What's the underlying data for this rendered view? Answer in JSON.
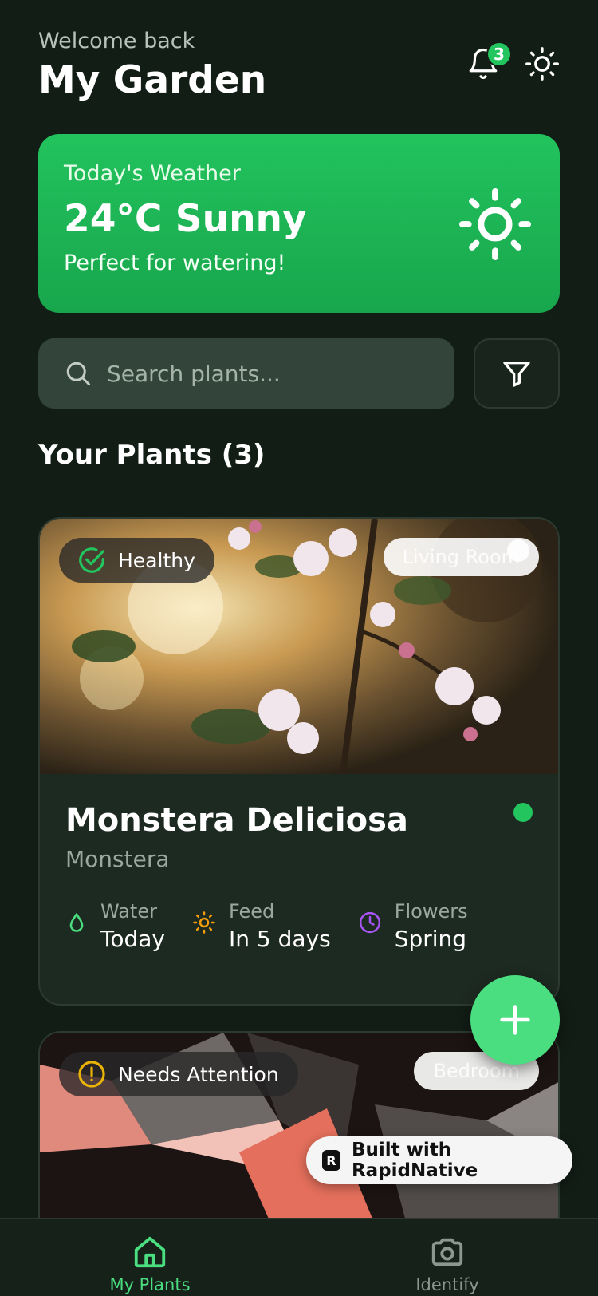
{
  "header": {
    "welcome": "Welcome back",
    "title": "My Garden",
    "notifications_count": "3"
  },
  "weather": {
    "label": "Today's Weather",
    "temperature": "24°C Sunny",
    "note": "Perfect for watering!"
  },
  "search": {
    "placeholder": "Search plants..."
  },
  "plants_section": {
    "title": "Your Plants (3)"
  },
  "plants": [
    {
      "status": "Healthy",
      "room": "Living Room",
      "name": "Monstera Deliciosa",
      "type": "Monstera",
      "stats": [
        {
          "label": "Water",
          "value": "Today"
        },
        {
          "label": "Feed",
          "value": "In 5 days"
        },
        {
          "label": "Flowers",
          "value": "Spring"
        }
      ]
    },
    {
      "status": "Needs Attention",
      "room": "Bedroom"
    }
  ],
  "built_with": "Built with RapidNative",
  "tabs": [
    {
      "label": "My Plants"
    },
    {
      "label": "Identify"
    }
  ],
  "colors": {
    "background": "#121d16",
    "accent": "#22c55e",
    "fab": "#4ade80",
    "attention": "#eab308",
    "feed": "#f59e0b",
    "flowers": "#a855f7"
  }
}
